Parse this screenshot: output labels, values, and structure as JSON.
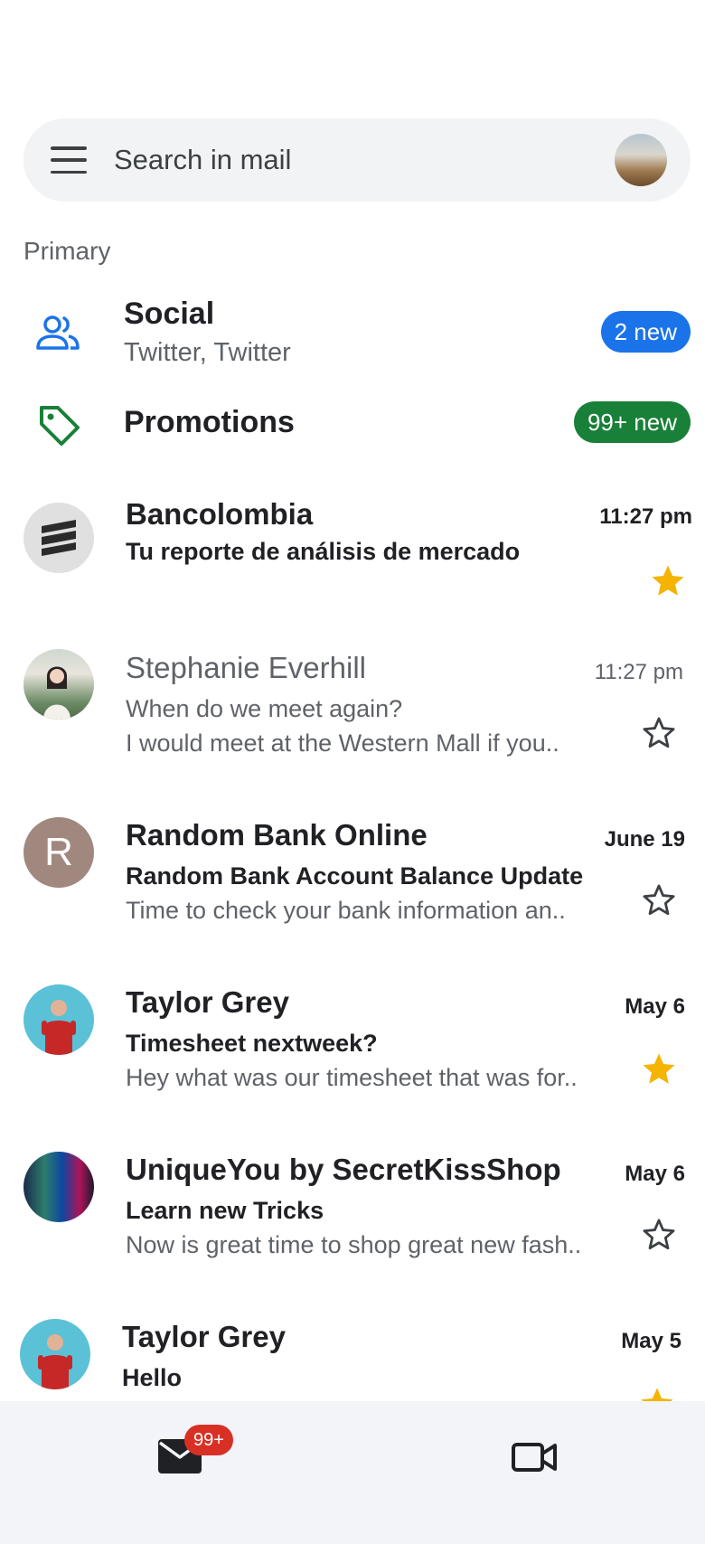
{
  "search": {
    "placeholder": "Search in mail"
  },
  "section_label": "Primary",
  "categories": [
    {
      "title": "Social",
      "subtitle": "Twitter, Twitter",
      "badge": "2 new",
      "badge_color": "#1a73e8",
      "icon": "people-icon"
    },
    {
      "title": "Promotions",
      "subtitle": "",
      "badge": "99+ new",
      "badge_color": "#188038",
      "icon": "tag-icon"
    }
  ],
  "mails": [
    {
      "sender": "Bancolombia",
      "time": "11:27 pm",
      "subject": "Tu reporte de análisis de mercado",
      "snippet": "",
      "starred": true,
      "unread": true,
      "avatar": "bancolombia-logo"
    },
    {
      "sender": "Stephanie Everhill",
      "time": "11:27 pm",
      "subject": "When do we meet again?",
      "snippet": "I would meet at the Western Mall if you..",
      "starred": false,
      "unread": false,
      "avatar": "photo"
    },
    {
      "sender": "Random Bank Online",
      "time": "June 19",
      "subject": "Random Bank Account Balance Update",
      "snippet": "Time to check your bank information an..",
      "starred": false,
      "unread": true,
      "avatar": "letter",
      "avatar_letter": "R"
    },
    {
      "sender": "Taylor Grey",
      "time": "May 6",
      "subject": "Timesheet nextweek?",
      "snippet": "Hey what was our timesheet that was for..",
      "starred": true,
      "unread": true,
      "avatar": "photo"
    },
    {
      "sender": "UniqueYou by SecretKissShop",
      "time": "May 6",
      "subject": "Learn new Tricks",
      "snippet": "Now is great time to shop great new fash..",
      "starred": false,
      "unread": true,
      "avatar": "photo"
    },
    {
      "sender": "Taylor Grey",
      "time": "May 5",
      "subject": "Hello",
      "snippet": "",
      "starred": true,
      "unread": true,
      "avatar": "photo"
    }
  ],
  "bottom_nav": {
    "mail_badge": "99+"
  },
  "colors": {
    "star": "#f4b400",
    "accent_blue": "#1a73e8",
    "accent_green": "#188038",
    "badge_red": "#d93025"
  }
}
